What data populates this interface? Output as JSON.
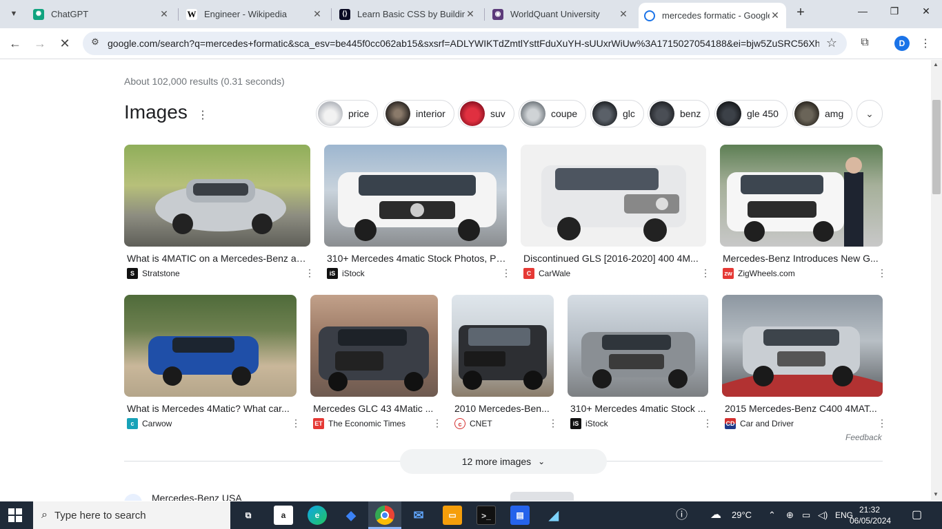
{
  "tabs": [
    {
      "title": "ChatGPT",
      "icon": "chatgpt-icon"
    },
    {
      "title": "Engineer - Wikipedia",
      "icon": "wikipedia-icon"
    },
    {
      "title": "Learn Basic CSS by Building",
      "icon": "freecodecamp-icon"
    },
    {
      "title": "WorldQuant University",
      "icon": "worldquant-icon"
    },
    {
      "title": "mercedes formatic - Google",
      "icon": "google-icon"
    }
  ],
  "toolbar": {
    "url": "google.com/search?q=mercedes+formatic&sca_esv=be445f0cc062ab15&sxsrf=ADLYWIKTdZmtlYsttFduXuYH-sUUxrWiUw%3A1715027054188&ei=bjw5ZuSRC56Xhbl...",
    "profile_initial": "D"
  },
  "search": {
    "stats": "About 102,000 results (0.31 seconds)",
    "images_heading": "Images",
    "chips": [
      "price",
      "interior",
      "suv",
      "coupe",
      "glc",
      "benz",
      "gle 450",
      "amg"
    ],
    "feedback": "Feedback",
    "more_images": "12 more images",
    "next_result": "Mercedes-Benz USA"
  },
  "images": [
    {
      "caption": "What is 4MATIC on a Mercedes-Benz an...",
      "source": "Stratstone",
      "logo": "S"
    },
    {
      "caption": "310+ Mercedes 4matic Stock Photos, Pi...",
      "source": "iStock",
      "logo": "iS"
    },
    {
      "caption": "Discontinued GLS [2016-2020] 400 4M...",
      "source": "CarWale",
      "logo": "C"
    },
    {
      "caption": "Mercedes-Benz Introduces New G...",
      "source": "ZigWheels.com",
      "logo": "zw"
    },
    {
      "caption": "What is Mercedes 4Matic? What car...",
      "source": "Carwow",
      "logo": "c"
    },
    {
      "caption": "Mercedes GLC 43 4Matic ...",
      "source": "The Economic Times",
      "logo": "ET"
    },
    {
      "caption": "2010 Mercedes-Ben...",
      "source": "CNET",
      "logo": "c"
    },
    {
      "caption": "310+ Mercedes 4matic Stock ...",
      "source": "iStock",
      "logo": "iS"
    },
    {
      "caption": "2015 Mercedes-Benz C400 4MAT...",
      "source": "Car and Driver",
      "logo": "CD"
    }
  ],
  "taskbar": {
    "search_placeholder": "Type here to search",
    "weather": "29°C",
    "language": "ENG",
    "time": "21:32",
    "date": "06/05/2024"
  },
  "colors": {
    "accent": "#1a73e8",
    "tabstrip": "#dee3ea",
    "taskbar": "#1f2a38"
  }
}
